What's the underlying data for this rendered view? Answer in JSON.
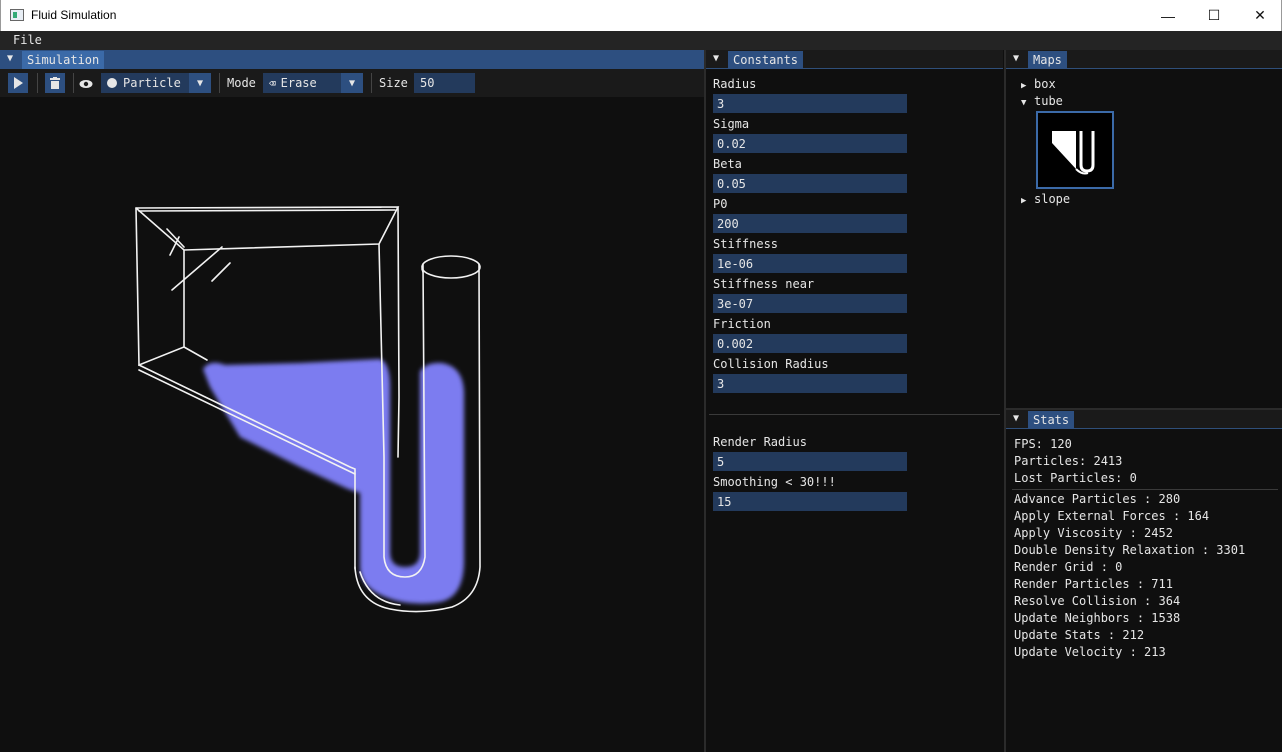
{
  "window": {
    "title": "Fluid Simulation",
    "minimize_glyph": "—",
    "maximize_glyph": "☐",
    "close_glyph": "✕"
  },
  "menu": {
    "file": "File"
  },
  "simulation": {
    "tab": "Simulation",
    "toolbar": {
      "play_icon": "play-icon",
      "trash_icon": "trash-icon",
      "eye_icon": "eye-icon",
      "brush": "Particle",
      "mode_label": "Mode",
      "mode_value": "Erase",
      "size_label": "Size",
      "size_value": "50"
    },
    "fluid_color": "#7b7bf0"
  },
  "constants": {
    "tab": "Constants",
    "fields": [
      {
        "label": "Radius",
        "value": "3"
      },
      {
        "label": "Sigma",
        "value": "0.02"
      },
      {
        "label": "Beta",
        "value": "0.05"
      },
      {
        "label": "P0",
        "value": "200"
      },
      {
        "label": "Stiffness",
        "value": "1e-06"
      },
      {
        "label": "Stiffness near",
        "value": "3e-07"
      },
      {
        "label": "Friction",
        "value": "0.002"
      },
      {
        "label": "Collision Radius",
        "value": "3"
      }
    ],
    "render_fields": [
      {
        "label": "Render Radius",
        "value": "5"
      },
      {
        "label": "Smoothing < 30!!!",
        "value": "15"
      }
    ]
  },
  "maps": {
    "tab": "Maps",
    "items": [
      {
        "label": "box",
        "expanded": false
      },
      {
        "label": "tube",
        "expanded": true
      },
      {
        "label": "slope",
        "expanded": false
      }
    ]
  },
  "stats": {
    "tab": "Stats",
    "summary": [
      "FPS: 120",
      "Particles: 2413",
      "Lost Particles: 0"
    ],
    "timings": [
      "Advance Particles : 280",
      "Apply External Forces : 164",
      "Apply Viscosity : 2452",
      "Double Density Relaxation : 3301",
      "Render Grid : 0",
      "Render Particles : 711",
      "Resolve Collision : 364",
      "Update Neighbors : 1538",
      "Update Stats : 212",
      "Update Velocity : 213"
    ]
  },
  "colors": {
    "accent": "#2d4f80",
    "input_bg": "#233a5c",
    "panel_bg": "#0f0f0f"
  }
}
